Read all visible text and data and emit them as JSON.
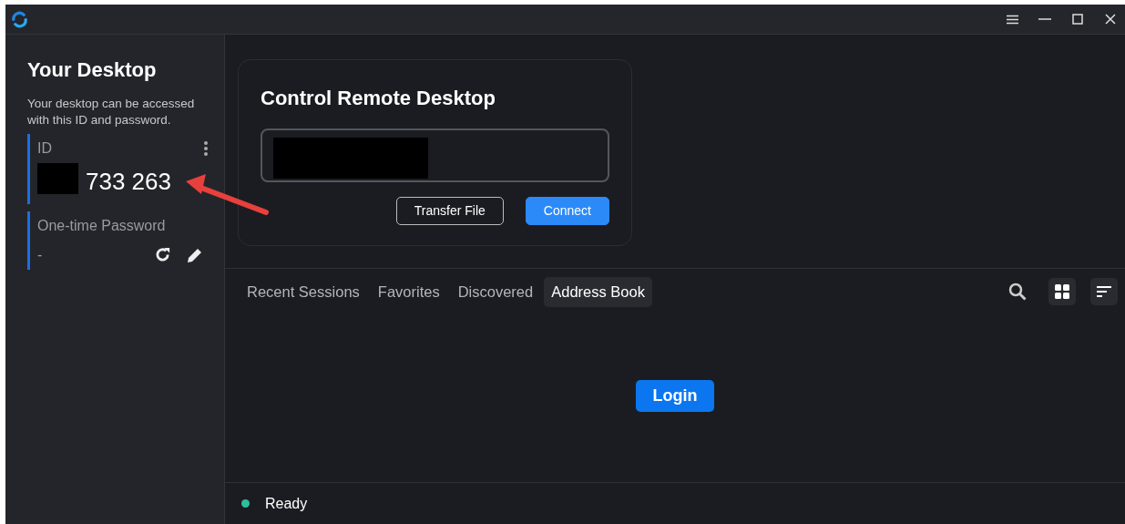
{
  "sidebar": {
    "title": "Your Desktop",
    "description": "Your desktop can be accessed with this ID and password.",
    "id_field": {
      "label": "ID",
      "value": "733 263",
      "redacted": true
    },
    "password_field": {
      "label": "One-time Password",
      "value": "-"
    }
  },
  "remote": {
    "title": "Control Remote Desktop",
    "input_redacted": true,
    "buttons": [
      {
        "label": "Transfer File",
        "kind": "outline"
      },
      {
        "label": "Connect",
        "kind": "primary"
      }
    ]
  },
  "tabs": [
    {
      "label": "Recent Sessions",
      "selected": false
    },
    {
      "label": "Favorites",
      "selected": false
    },
    {
      "label": "Discovered",
      "selected": false
    },
    {
      "label": "Address Book",
      "selected": true
    }
  ],
  "login_button": "Login",
  "status": {
    "text": "Ready",
    "color": "#2ebf9f"
  }
}
